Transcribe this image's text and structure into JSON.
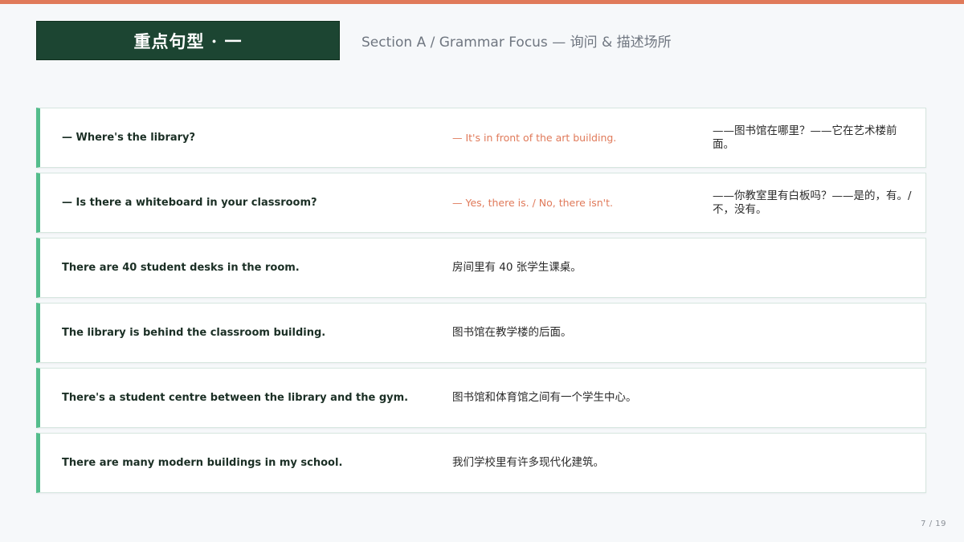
{
  "title": "重点句型 · 一",
  "subtitle": "Section A / Grammar Focus — 询问 & 描述场所",
  "rows": [
    {
      "en": "— Where's the library?",
      "answer": "— It's in front of the art building.",
      "zh": "——图书馆在哪里？——它在艺术楼前面。"
    },
    {
      "en": "— Is there a whiteboard in your classroom?",
      "answer": "— Yes, there is. / No, there isn't.",
      "zh": "——你教室里有白板吗？——是的，有。/ 不，没有。"
    },
    {
      "en": "There are 40 student desks in the room.",
      "zh": "房间里有 40 张学生课桌。"
    },
    {
      "en": "The library is behind the classroom building.",
      "zh": "图书馆在教学楼的后面。"
    },
    {
      "en": "There's a student centre between the library and the gym.",
      "zh": "图书馆和体育馆之间有一个学生中心。"
    },
    {
      "en": "There are many modern buildings in my school.",
      "zh": "我们学校里有许多现代化建筑。"
    }
  ],
  "page": "7 / 19",
  "colors": {
    "accent": "#e07a5a",
    "title_bg": "#1c4532",
    "row_border": "#54bd8c"
  }
}
